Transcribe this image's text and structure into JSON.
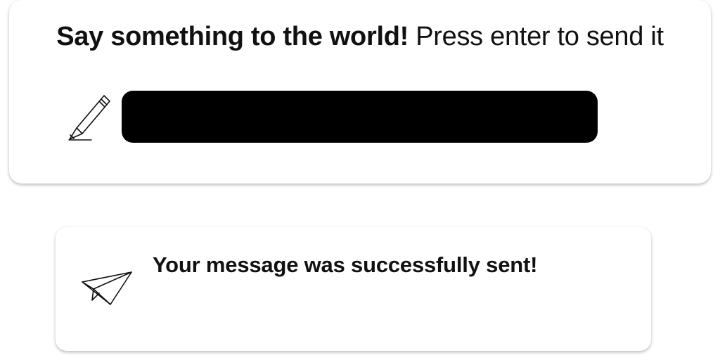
{
  "compose": {
    "heading_bold": "Say something to the world!",
    "heading_regular": "Press enter to send it",
    "input_value": "",
    "input_placeholder": "",
    "icon": "pencil-icon"
  },
  "notification": {
    "message": "Your message was successfully sent!",
    "icon": "paper-plane-icon"
  },
  "colors": {
    "background": "#ffffff",
    "text": "#111111",
    "input_fill": "#000000"
  }
}
